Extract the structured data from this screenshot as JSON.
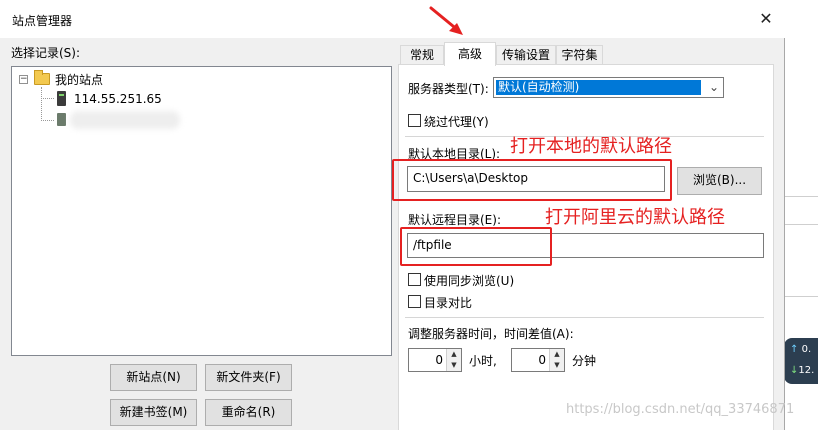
{
  "window": {
    "title": "站点管理器"
  },
  "left": {
    "select_label": "选择记录(S):",
    "tree": {
      "root_label": "我的站点",
      "sites": [
        {
          "label": "114.55.251.65"
        }
      ]
    },
    "buttons": {
      "new_site": "新站点(N)",
      "new_folder": "新文件夹(F)",
      "new_bookmark": "新建书签(M)",
      "rename": "重命名(R)"
    }
  },
  "tabs": [
    {
      "label": "常规",
      "active": false
    },
    {
      "label": "高级",
      "active": true
    },
    {
      "label": "传输设置",
      "active": false
    },
    {
      "label": "字符集",
      "active": false
    }
  ],
  "advanced": {
    "server_type_label": "服务器类型(T):",
    "server_type_value": "默认(自动检测)",
    "bypass_proxy_label": "绕过代理(Y)",
    "bypass_proxy_checked": false,
    "local_dir_label": "默认本地目录(L):",
    "local_dir_value": "C:\\Users\\a\\Desktop",
    "browse_button": "浏览(B)...",
    "remote_dir_label": "默认远程目录(E):",
    "remote_dir_value": "/ftpfile",
    "sync_browse_label": "使用同步浏览(U)",
    "sync_browse_checked": false,
    "dir_compare_label": "目录对比",
    "dir_compare_checked": false,
    "time_adjust_label": "调整服务器时间，时间差值(A):",
    "hours_value": "0",
    "hours_unit": "小时,",
    "minutes_value": "0",
    "minutes_unit": "分钟"
  },
  "annotations": {
    "local_note": "打开本地的默认路径",
    "remote_note": "打开阿里云的默认路径",
    "color": "#e52121"
  },
  "background": {
    "widget_rows": [
      {
        "arrow": "↑",
        "text": "0."
      },
      {
        "arrow": "↓",
        "text": "12."
      }
    ],
    "watermark": "https://blog.csdn.net/qq_33746871"
  },
  "colors": {
    "selection_blue": "#0078d7",
    "dialog_bg": "#f0f0f0"
  }
}
